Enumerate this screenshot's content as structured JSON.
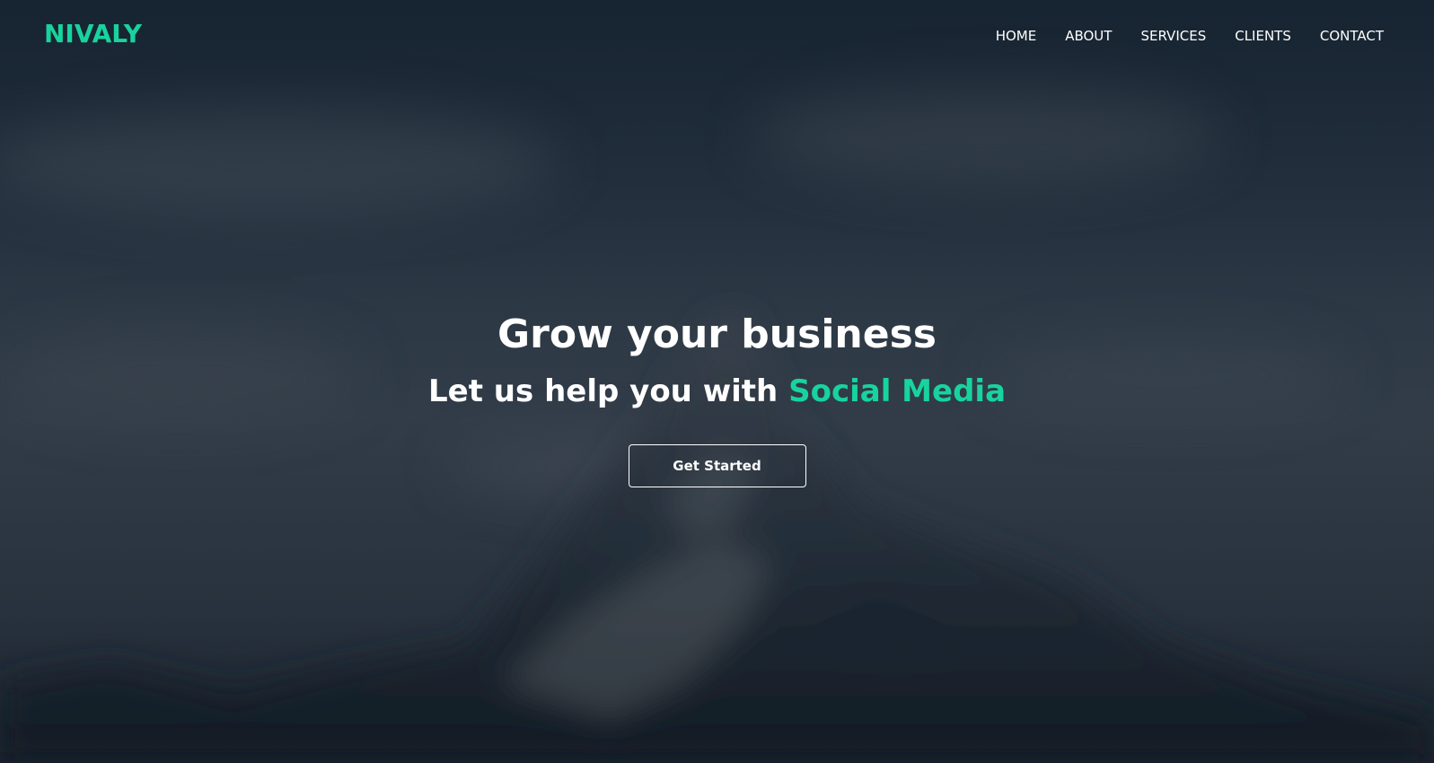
{
  "brand": {
    "name": "NIVALY",
    "accent_color": "#18d39e"
  },
  "nav": {
    "items": [
      {
        "label": "HOME"
      },
      {
        "label": "ABOUT"
      },
      {
        "label": "SERVICES"
      },
      {
        "label": "CLIENTS"
      },
      {
        "label": "CONTACT"
      }
    ]
  },
  "hero": {
    "title": "Grow your business",
    "subtitle_prefix": "Let us help you with ",
    "subtitle_highlight": "Social Media",
    "cta_label": "Get Started",
    "background": "blurred-mountain-photo"
  }
}
